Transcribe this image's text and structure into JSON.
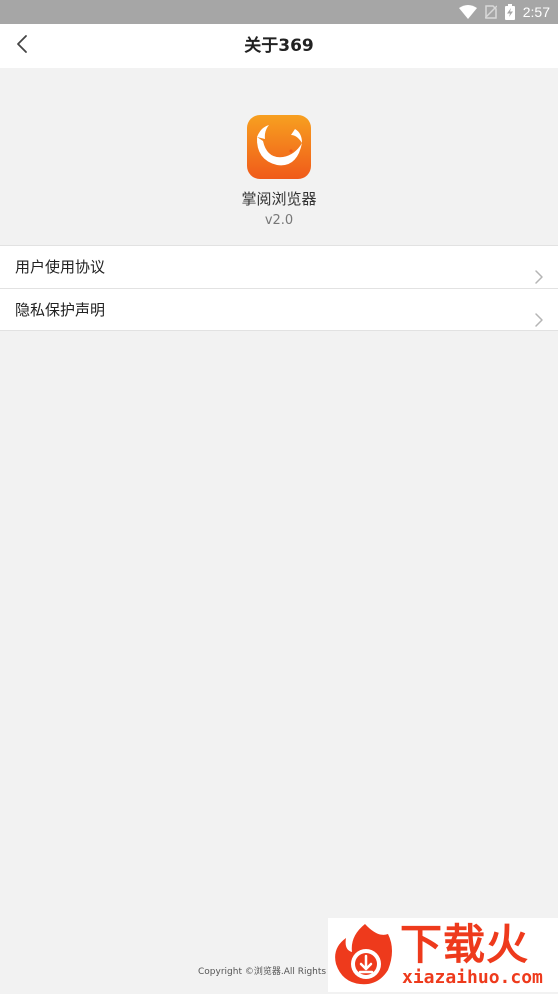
{
  "status_bar": {
    "time": "2:57"
  },
  "header": {
    "title": "关于369"
  },
  "app": {
    "name": "掌阅浏览器",
    "version": "v2.0"
  },
  "menu": {
    "items": [
      {
        "label": "用户使用协议"
      },
      {
        "label": "隐私保护声明"
      }
    ]
  },
  "footer": {
    "copyright": "Copyright ©浏览器.All Rights Re"
  },
  "watermark": {
    "title": "下载火",
    "url": "xiazaihuo.com"
  },
  "colors": {
    "accent_orange": "#f58a1f",
    "watermark_red": "#ee3a1c"
  }
}
